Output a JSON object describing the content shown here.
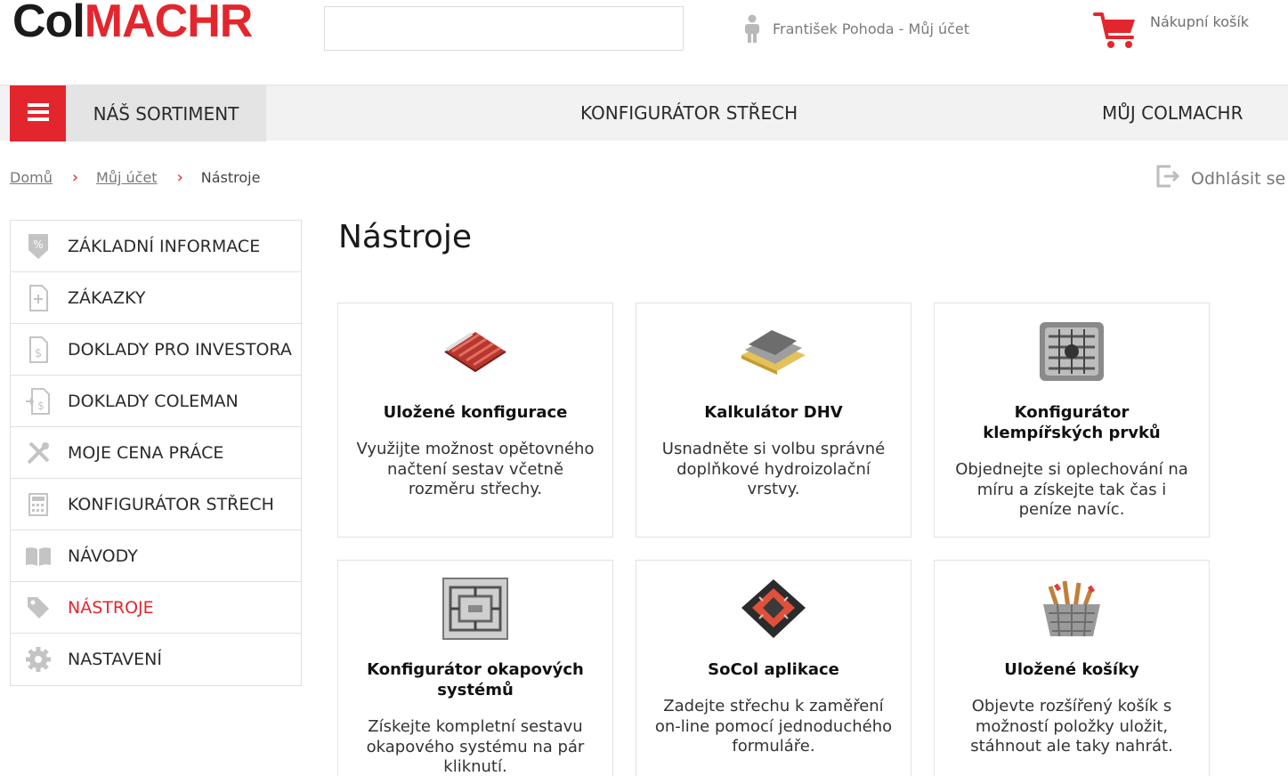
{
  "header": {
    "logo_col": "Col",
    "logo_machr": "MACHR",
    "account_label": "František Pohoda - Můj účet",
    "cart_label": "Nákupní košík"
  },
  "nav": {
    "sortiment": "NÁŠ SORTIMENT",
    "roof_configurator": "KONFIGURÁTOR STŘECH",
    "my_colmachr": "MŮJ COLMACHR"
  },
  "breadcrumb": {
    "home": "Domů",
    "account": "Můj účet",
    "current": "Nástroje"
  },
  "logout_label": "Odhlásit se",
  "sidebar": {
    "items": [
      {
        "label": "ZÁKLADNÍ INFORMACE",
        "icon": "percent-tag-icon"
      },
      {
        "label": "ZÁKAZKY",
        "icon": "document-plus-icon"
      },
      {
        "label": "DOKLADY PRO INVESTORA",
        "icon": "document-dollar-icon"
      },
      {
        "label": "DOKLADY COLEMAN",
        "icon": "document-arrow-dollar-icon"
      },
      {
        "label": "MOJE CENA PRÁCE",
        "icon": "tools-icon"
      },
      {
        "label": "KONFIGURÁTOR STŘECH",
        "icon": "calculator-icon"
      },
      {
        "label": "NÁVODY",
        "icon": "book-icon"
      },
      {
        "label": "NÁSTROJE",
        "icon": "tags-icon"
      },
      {
        "label": "NASTAVENÍ",
        "icon": "gear-icon"
      }
    ]
  },
  "page_title": "Nástroje",
  "cards": [
    {
      "title": "Uložené konfigurace",
      "text": "Využijte možnost opětovného načtení sestav včetně rozměru střechy."
    },
    {
      "title": "Kalkulátor DHV",
      "text": "Usnadněte si volbu správné doplňkové hydroizolační vrstvy."
    },
    {
      "title": "Konfigurátor klempířských prvků",
      "text": "Objednejte si oplechování na míru a získejte tak čas i peníze navíc."
    },
    {
      "title": "Konfigurátor okapových systémů",
      "text": "Získejte kompletní sestavu okapového systému na pár kliknutí."
    },
    {
      "title": "SoCol aplikace",
      "text": "Zadejte střechu k zaměření on-line pomocí jednoduchého formuláře."
    },
    {
      "title": "Uložené košíky",
      "text": "Objevte rozšířený košík s možností položky uložit, stáhnout ale taky nahrát."
    }
  ],
  "colors": {
    "brand_red": "#e3262d",
    "nav_bg": "#f2f2f2",
    "sortiment_bg": "#e4e4e4"
  }
}
